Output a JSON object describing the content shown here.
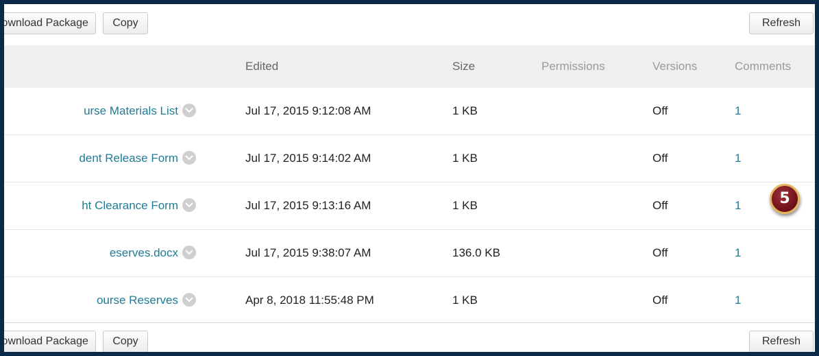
{
  "toolbar": {
    "download_label": "Download Package",
    "copy_label": "Copy",
    "refresh_label": "Refresh"
  },
  "columns": {
    "edited": "Edited",
    "size": "Size",
    "permissions": "Permissions",
    "versions": "Versions",
    "comments": "Comments"
  },
  "rows": [
    {
      "name": "urse Materials List",
      "edited": "Jul 17, 2015 9:12:08 AM",
      "size": "1 KB",
      "versions": "Off",
      "comments": "1"
    },
    {
      "name": "dent Release Form",
      "edited": "Jul 17, 2015 9:14:02 AM",
      "size": "1 KB",
      "versions": "Off",
      "comments": "1"
    },
    {
      "name": "ht Clearance Form",
      "edited": "Jul 17, 2015 9:13:16 AM",
      "size": "1 KB",
      "versions": "Off",
      "comments": "1"
    },
    {
      "name": "eserves.docx",
      "edited": "Jul 17, 2015 9:38:07 AM",
      "size": "136.0 KB",
      "versions": "Off",
      "comments": "1"
    },
    {
      "name": "ourse Reserves",
      "edited": "Apr 8, 2018 11:55:48 PM",
      "size": "1 KB",
      "versions": "Off",
      "comments": "1"
    }
  ],
  "callout": {
    "number": "5",
    "colors": {
      "fill": "#7a1520",
      "ring": "#e3b45a"
    }
  },
  "colors": {
    "link": "#1f7c94",
    "frame": "#0b2a4a",
    "header_bg": "#efefef"
  }
}
